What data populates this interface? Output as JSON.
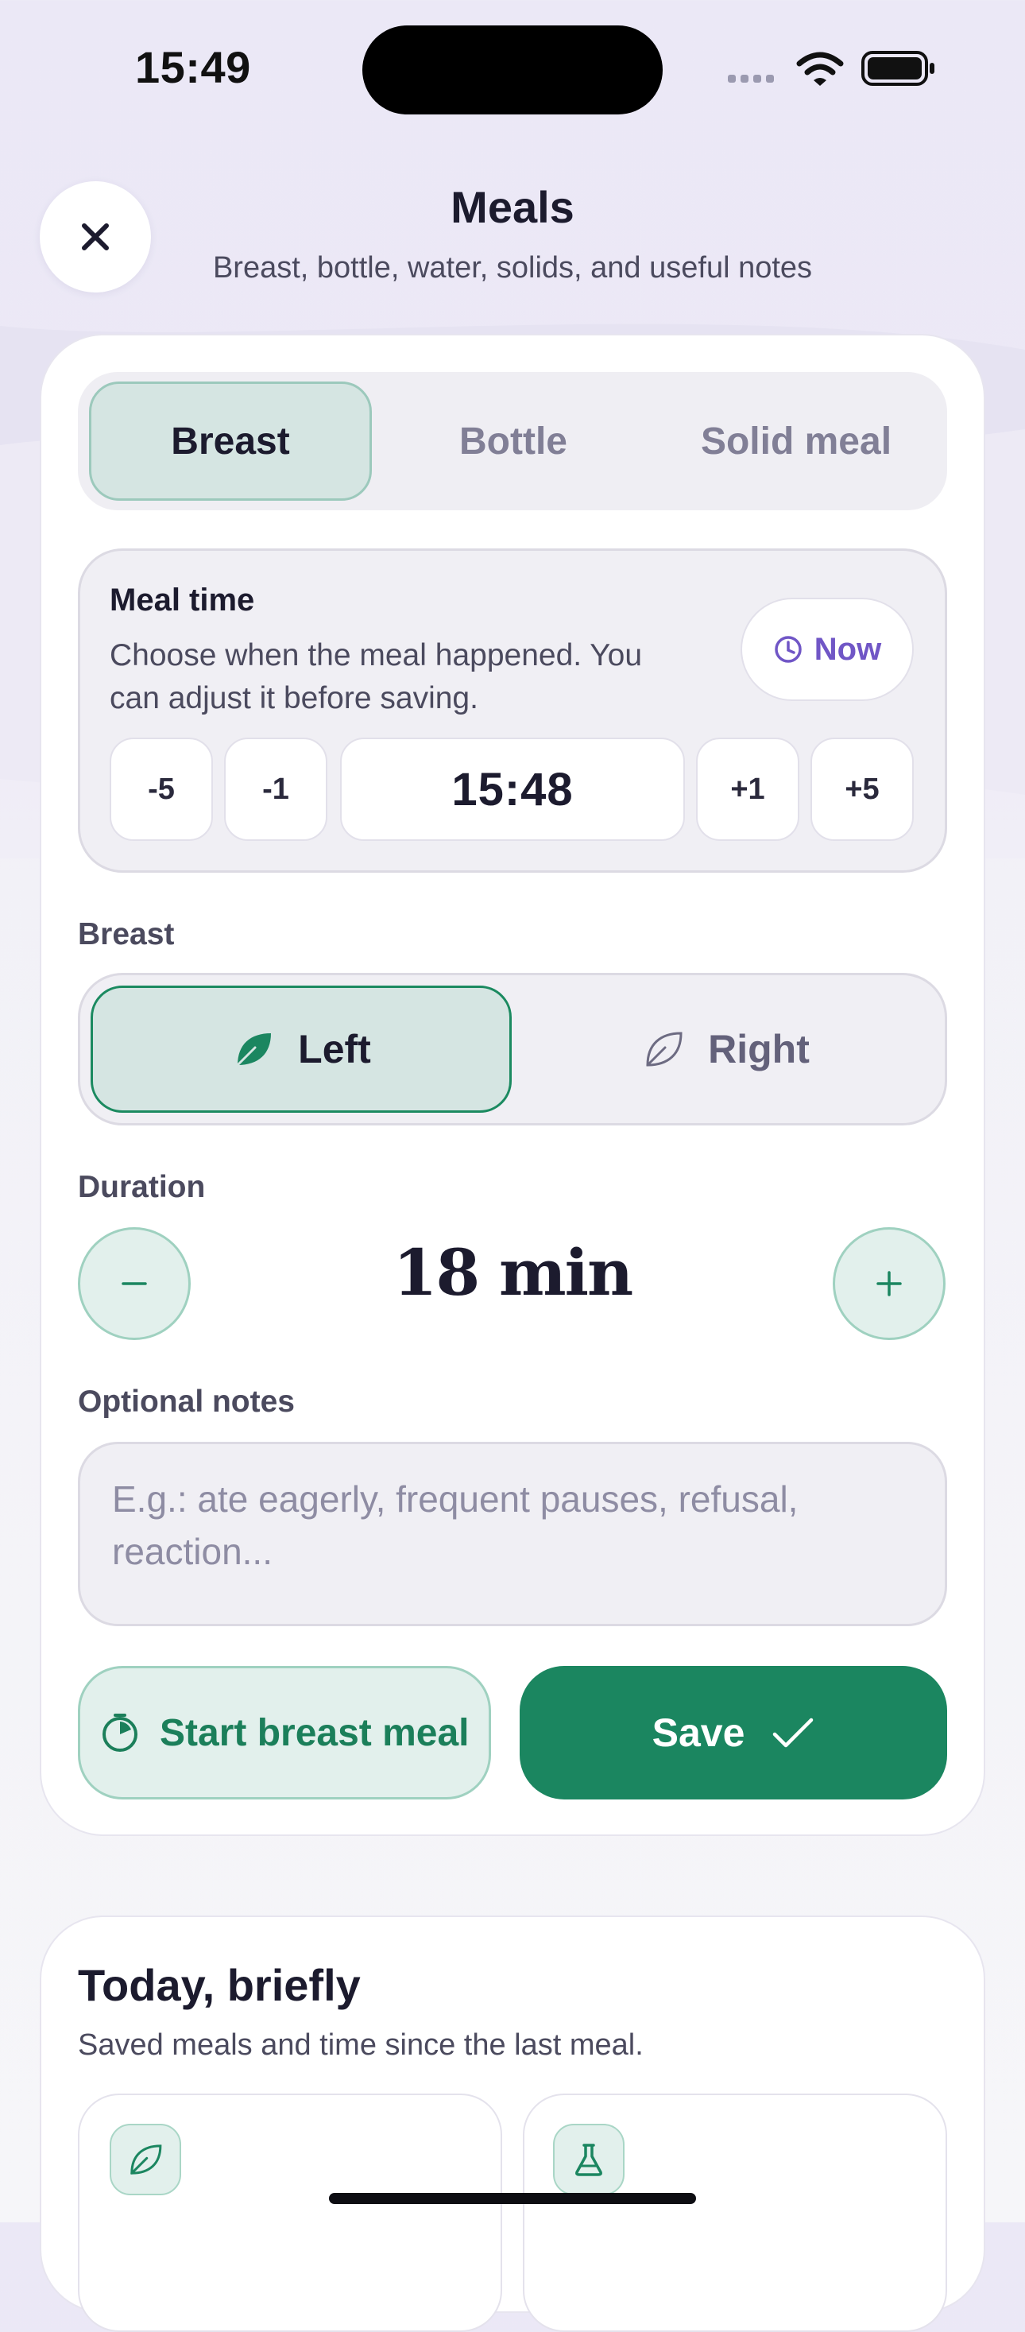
{
  "status_bar": {
    "time": "15:49"
  },
  "header": {
    "close_icon": "close-icon",
    "title": "Meals",
    "subtitle": "Breast, bottle, water, solids, and useful notes"
  },
  "tabs": [
    {
      "label": "Breast",
      "active": true
    },
    {
      "label": "Bottle",
      "active": false
    },
    {
      "label": "Solid meal",
      "active": false
    }
  ],
  "meal_time": {
    "label": "Meal time",
    "description": "Choose when the meal happened. You can adjust it before saving.",
    "now_label": "Now",
    "steps": [
      "-5",
      "-1",
      "+1",
      "+5"
    ],
    "value": "15:48"
  },
  "breast_side": {
    "label": "Breast",
    "options": [
      {
        "label": "Left",
        "selected": true,
        "icon": "leaf-filled-icon"
      },
      {
        "label": "Right",
        "selected": false,
        "icon": "leaf-outline-icon"
      }
    ]
  },
  "duration": {
    "label": "Duration",
    "value": "18 min"
  },
  "notes": {
    "label": "Optional notes",
    "placeholder": "E.g.: ate eagerly, frequent pauses, refusal, reaction...",
    "value": ""
  },
  "actions": {
    "start_label": "Start breast meal",
    "save_label": "Save"
  },
  "summary": {
    "title": "Today, briefly",
    "subtitle": "Saved meals and time since the last meal.",
    "cards": [
      {
        "icon": "leaf-icon"
      },
      {
        "icon": "flask-icon"
      }
    ]
  },
  "colors": {
    "accent_green": "#1b8660",
    "accent_purple": "#7056c6",
    "text_primary": "#1c1b2e"
  }
}
